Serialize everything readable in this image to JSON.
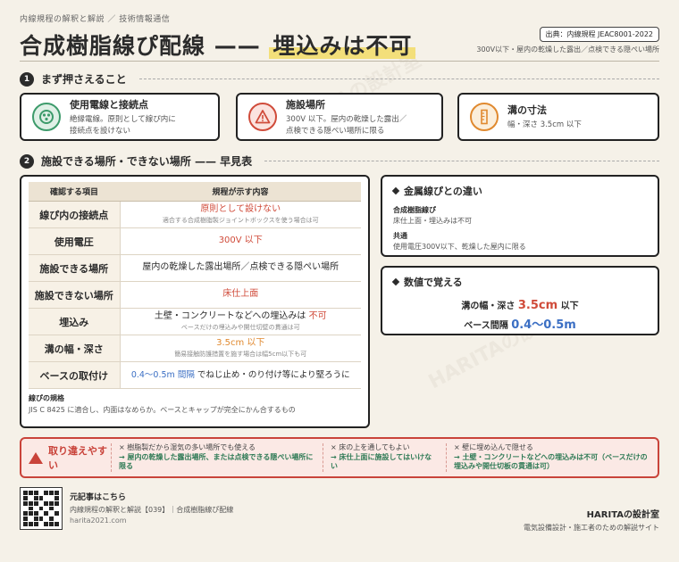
{
  "header": {
    "kicker": "内線規程の解釈と解説 ／ 技術情報通信",
    "title_main": "合成樹脂線ぴ配線 —— ",
    "title_highlight": "埋込みは不可",
    "source": "出典：内線規程 JEAC8001-2022",
    "scope": "300V以下・屋内の乾燥した露出／点検できる隠ぺい場所"
  },
  "section1": {
    "number": "1",
    "title": "まず押さえること",
    "cards": [
      {
        "title": "使用電線と接続点",
        "body1": "絶縁電線。原則として線ぴ内に",
        "body2": "接続点を設けない",
        "icon": "wire-cross-section-icon",
        "color": "#3d9b6b"
      },
      {
        "title": "施設場所",
        "body1": "300V 以下。屋内の乾燥した露出／",
        "body2": "点検できる隠ぺい場所に限る",
        "icon": "warning-icon",
        "color": "#d04b3a"
      },
      {
        "title": "溝の寸法",
        "body1": "幅・深さ 3.5cm 以下",
        "body2": "",
        "icon": "ruler-icon",
        "color": "#e0892f"
      }
    ]
  },
  "section2": {
    "number": "2",
    "title": "施設できる場所・できない場所 —— 早見表",
    "table": {
      "headers": [
        "確認する項目",
        "規程が示す内容"
      ],
      "rows": [
        {
          "item": "線ぴ内の接続点",
          "value": "原則として設けない",
          "sub": "適合する合成樹脂製ジョイントボックスを使う場合は可",
          "color": "red"
        },
        {
          "item": "使用電圧",
          "value": "300V 以下",
          "sub": "",
          "color": "red"
        },
        {
          "item": "施設できる場所",
          "value": "屋内の乾燥した露出場所／点検できる隠ぺい場所",
          "sub": "",
          "color": "plain"
        },
        {
          "item": "施設できない場所",
          "value": "床仕上面",
          "sub": "",
          "color": "red"
        },
        {
          "item": "埋込み",
          "value_pre": "土壁・コンクリートなどへの埋込みは ",
          "value": "不可",
          "sub": "ベースだけの埋込みや開仕切壁の貫通は可",
          "color": "red"
        },
        {
          "item": "溝の幅・深さ",
          "value": "3.5cm 以下",
          "sub": "簡易接触防護措置を施す場合は幅5cm以下も可",
          "color": "orange"
        },
        {
          "item": "ベースの取付け",
          "value": "0.4〜0.5m 間隔",
          "value_post": " でねじ止め・のり付け等により堅ろうに",
          "sub": "",
          "color": "blue"
        }
      ],
      "note_title": "線ぴの規格",
      "note_body": "JIS C 8425 に適合し、内面はなめらか。ベースとキャップが完全にかん合するもの"
    }
  },
  "side": {
    "diff": {
      "title": "金属線ぴとの違い",
      "a_title": "合成樹脂線ぴ",
      "a_body": "床仕上面・埋込みは不可",
      "b_title": "共通",
      "b_body": "使用電圧300V以下、乾燥した屋内に限る"
    },
    "numbers": {
      "title": "数値で覚える",
      "row1_label": "溝の幅・深さ ",
      "row1_value": "3.5cm",
      "row1_suffix": " 以下",
      "row2_label": "ベース間隔 ",
      "row2_value": "0.4〜0.5m"
    }
  },
  "mistake": {
    "label": "取り違えやすい",
    "cols": [
      {
        "wrong": "× 樹脂製だから湿気の多い場所でも使える",
        "fix": "→ 屋内の乾燥した露出場所、または点検できる隠ぺい場所に限る"
      },
      {
        "wrong": "× 床の上を通してもよい",
        "fix": "→ 床仕上面に施設してはいけない"
      },
      {
        "wrong": "× 壁に埋め込んで隠せる",
        "fix": "→ 土壁・コンクリートなどへの埋込みは不可（ベースだけの埋込みや開仕切板の貫通は可）"
      }
    ]
  },
  "footer": {
    "label": "元記事はこちら",
    "line1": "内線規程の解釈と解説【039】｜合成樹脂線ぴ配線",
    "url": "harita2021.com",
    "brand": "HARITAの設計室",
    "tagline": "電気設備設計・施工者のための解説サイト",
    "watermark": "HARITAの設計室"
  }
}
